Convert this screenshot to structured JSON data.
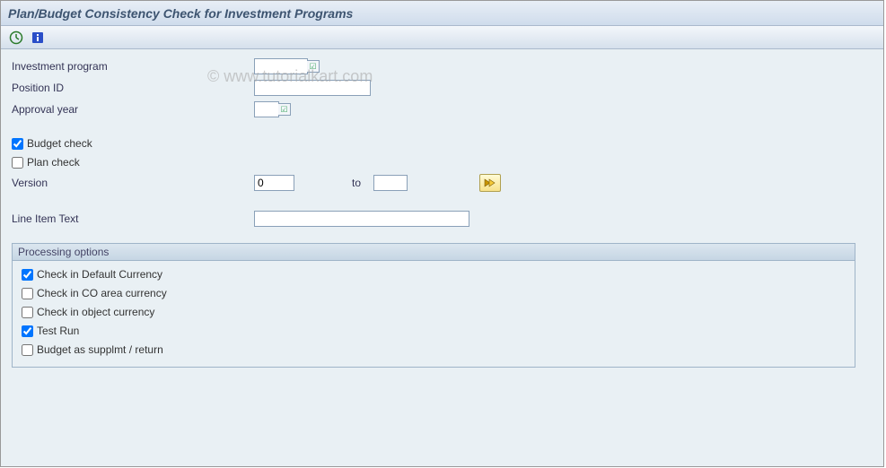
{
  "title": "Plan/Budget Consistency Check for Investment Programs",
  "watermark": "© www.tutorialkart.com",
  "fields": {
    "investment_program": {
      "label": "Investment program",
      "value": ""
    },
    "position_id": {
      "label": "Position ID",
      "value": ""
    },
    "approval_year": {
      "label": "Approval year",
      "value": ""
    },
    "budget_check": {
      "label": "Budget check",
      "checked": true
    },
    "plan_check": {
      "label": "Plan check",
      "checked": false
    },
    "version": {
      "label": "Version",
      "from": "0",
      "to_label": "to",
      "to": ""
    },
    "line_item_text": {
      "label": "Line Item Text",
      "value": ""
    }
  },
  "group": {
    "title": "Processing options",
    "options": {
      "default_currency": {
        "label": "Check in Default Currency",
        "checked": true
      },
      "co_area_currency": {
        "label": "Check in CO area currency",
        "checked": false
      },
      "object_currency": {
        "label": "Check in object currency",
        "checked": false
      },
      "test_run": {
        "label": "Test Run",
        "checked": true
      },
      "budget_supp_return": {
        "label": "Budget as supplmt / return",
        "checked": false
      }
    }
  }
}
